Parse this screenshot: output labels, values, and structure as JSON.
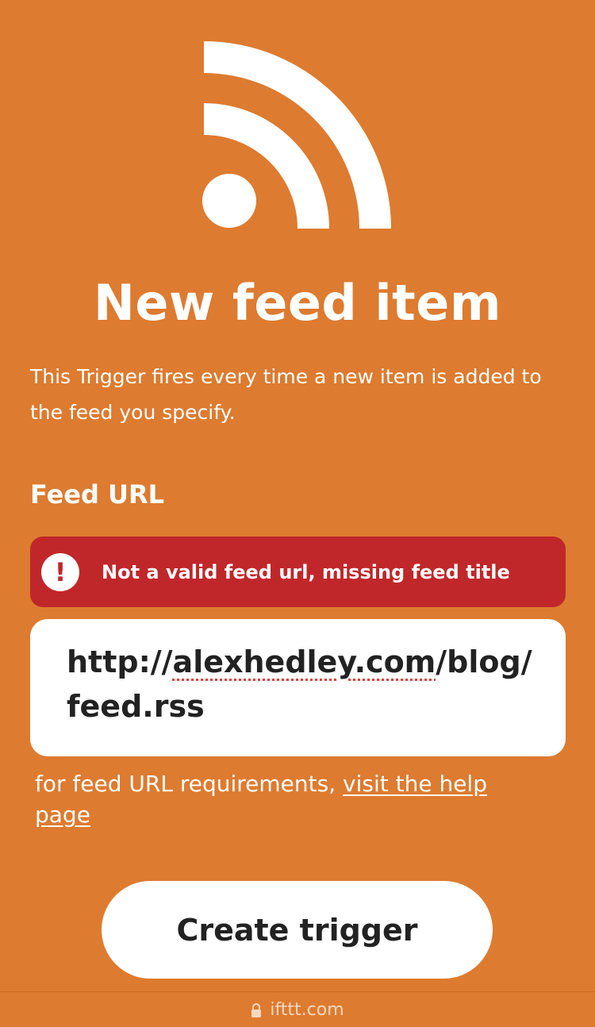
{
  "header": {
    "icon": "rss-feed-icon",
    "title": "New feed item",
    "description": "This Trigger fires every time a new item is added to the feed you specify."
  },
  "form": {
    "field_label": "Feed URL",
    "error": {
      "icon": "exclamation-icon",
      "message": "Not a valid feed url, missing feed title"
    },
    "url_parts": {
      "prefix": "http://",
      "domain": "alexhedley.com",
      "suffix": "/blog/feed.rss"
    },
    "help_text": "for feed URL requirements, ",
    "help_link": "visit the help page"
  },
  "actions": {
    "create_label": "Create trigger"
  },
  "browser": {
    "lock_icon": "lock-icon",
    "domain": "ifttt.com"
  },
  "colors": {
    "background": "#DD7B30",
    "error": "#C0272A",
    "text_dark": "#222222"
  }
}
